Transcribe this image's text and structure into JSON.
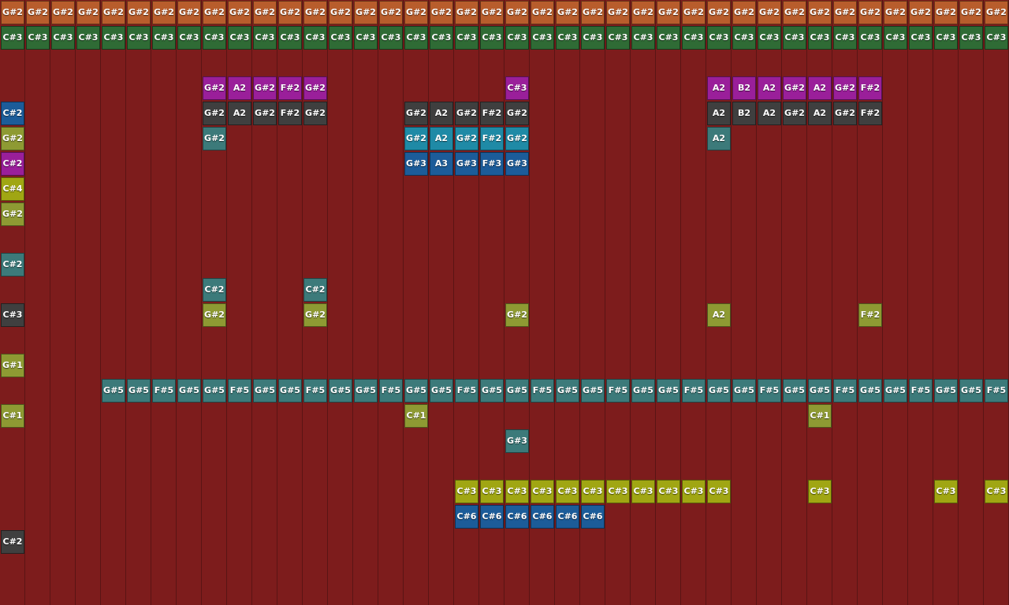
{
  "colors": {
    "background": "#7d1c1c",
    "orange": "#b85d2c",
    "green": "#2f6b35",
    "magenta": "#9a1f9a",
    "blue": "#1c5c99",
    "gray": "#3f3f3f",
    "olive": "#8e9a33",
    "cyan": "#1f8aa6",
    "teal": "#3c7a7a",
    "yellow": "#a0a613"
  },
  "tracks": [
    {
      "color": "orange",
      "notes": [
        [
          0,
          "G#2"
        ],
        [
          1,
          "G#2"
        ],
        [
          2,
          "G#2"
        ],
        [
          3,
          "G#2"
        ],
        [
          4,
          "G#2"
        ],
        [
          5,
          "G#2"
        ],
        [
          6,
          "G#2"
        ],
        [
          7,
          "G#2"
        ],
        [
          8,
          "G#2"
        ],
        [
          9,
          "G#2"
        ],
        [
          10,
          "G#2"
        ],
        [
          11,
          "G#2"
        ],
        [
          12,
          "G#2"
        ],
        [
          13,
          "G#2"
        ],
        [
          14,
          "G#2"
        ],
        [
          15,
          "G#2"
        ],
        [
          16,
          "G#2"
        ],
        [
          17,
          "G#2"
        ],
        [
          18,
          "G#2"
        ],
        [
          19,
          "G#2"
        ],
        [
          20,
          "G#2"
        ],
        [
          21,
          "G#2"
        ],
        [
          22,
          "G#2"
        ],
        [
          23,
          "G#2"
        ],
        [
          24,
          "G#2"
        ],
        [
          25,
          "G#2"
        ],
        [
          26,
          "G#2"
        ],
        [
          27,
          "G#2"
        ],
        [
          28,
          "G#2"
        ],
        [
          29,
          "G#2"
        ],
        [
          30,
          "G#2"
        ],
        [
          31,
          "G#2"
        ],
        [
          32,
          "G#2"
        ],
        [
          33,
          "G#2"
        ],
        [
          34,
          "G#2"
        ],
        [
          35,
          "G#2"
        ],
        [
          36,
          "G#2"
        ],
        [
          37,
          "G#2"
        ],
        [
          38,
          "G#2"
        ],
        [
          39,
          "G#2"
        ]
      ]
    },
    {
      "color": "green",
      "notes": [
        [
          0,
          "C#3"
        ],
        [
          1,
          "C#3"
        ],
        [
          2,
          "C#3"
        ],
        [
          3,
          "C#3"
        ],
        [
          4,
          "C#3"
        ],
        [
          5,
          "C#3"
        ],
        [
          6,
          "C#3"
        ],
        [
          7,
          "C#3"
        ],
        [
          8,
          "C#3"
        ],
        [
          9,
          "C#3"
        ],
        [
          10,
          "C#3"
        ],
        [
          11,
          "C#3"
        ],
        [
          12,
          "C#3"
        ],
        [
          13,
          "C#3"
        ],
        [
          14,
          "C#3"
        ],
        [
          15,
          "C#3"
        ],
        [
          16,
          "C#3"
        ],
        [
          17,
          "C#3"
        ],
        [
          18,
          "C#3"
        ],
        [
          19,
          "C#3"
        ],
        [
          20,
          "C#3"
        ],
        [
          21,
          "C#3"
        ],
        [
          22,
          "C#3"
        ],
        [
          23,
          "C#3"
        ],
        [
          24,
          "C#3"
        ],
        [
          25,
          "C#3"
        ],
        [
          26,
          "C#3"
        ],
        [
          27,
          "C#3"
        ],
        [
          28,
          "C#3"
        ],
        [
          29,
          "C#3"
        ],
        [
          30,
          "C#3"
        ],
        [
          31,
          "C#3"
        ],
        [
          32,
          "C#3"
        ],
        [
          33,
          "C#3"
        ],
        [
          34,
          "C#3"
        ],
        [
          35,
          "C#3"
        ],
        [
          36,
          "C#3"
        ],
        [
          37,
          "C#3"
        ],
        [
          38,
          "C#3"
        ],
        [
          39,
          "C#3"
        ]
      ]
    },
    {
      "color": "",
      "notes": []
    },
    {
      "color": "magenta",
      "notes": [
        [
          8,
          "G#2"
        ],
        [
          9,
          "A2"
        ],
        [
          10,
          "G#2"
        ],
        [
          11,
          "F#2"
        ],
        [
          12,
          "G#2"
        ],
        [
          20,
          "C#3"
        ],
        [
          28,
          "A2"
        ],
        [
          29,
          "B2"
        ],
        [
          30,
          "A2"
        ],
        [
          31,
          "G#2"
        ],
        [
          32,
          "A2"
        ],
        [
          33,
          "G#2"
        ],
        [
          34,
          "F#2"
        ]
      ]
    },
    {
      "color": "gray",
      "notes": [
        [
          8,
          "G#2"
        ],
        [
          9,
          "A2"
        ],
        [
          10,
          "G#2"
        ],
        [
          11,
          "F#2"
        ],
        [
          12,
          "G#2"
        ],
        [
          16,
          "G#2"
        ],
        [
          17,
          "A2"
        ],
        [
          18,
          "G#2"
        ],
        [
          19,
          "F#2"
        ],
        [
          20,
          "G#2"
        ],
        [
          28,
          "A2"
        ],
        [
          29,
          "B2"
        ],
        [
          30,
          "A2"
        ],
        [
          31,
          "G#2"
        ],
        [
          32,
          "A2"
        ],
        [
          33,
          "G#2"
        ],
        [
          34,
          "F#2"
        ]
      ]
    },
    {
      "color": "",
      "notes": []
    },
    {
      "color": "",
      "notes": []
    },
    {
      "color": "",
      "notes": []
    },
    {
      "color": "",
      "notes": []
    },
    {
      "color": "",
      "notes": []
    },
    {
      "color": "teal",
      "notes": [
        [
          0,
          "C#2"
        ]
      ]
    },
    {
      "color": "teal",
      "notes": [
        [
          8,
          "C#2"
        ],
        [
          12,
          "C#2"
        ]
      ]
    },
    {
      "color": "",
      "notes": []
    },
    {
      "color": "",
      "notes": []
    },
    {
      "color": "olive",
      "notes": [
        [
          0,
          "G#1"
        ]
      ]
    },
    {
      "color": "teal",
      "notes": [
        [
          4,
          "G#5"
        ],
        [
          5,
          "G#5"
        ],
        [
          6,
          "F#5"
        ],
        [
          7,
          "G#5"
        ],
        [
          8,
          "G#5"
        ],
        [
          9,
          "F#5"
        ],
        [
          10,
          "G#5"
        ],
        [
          11,
          "G#5"
        ],
        [
          12,
          "F#5"
        ],
        [
          13,
          "G#5"
        ],
        [
          14,
          "G#5"
        ],
        [
          15,
          "F#5"
        ],
        [
          16,
          "G#5"
        ],
        [
          17,
          "G#5"
        ],
        [
          18,
          "F#5"
        ],
        [
          19,
          "G#5"
        ],
        [
          20,
          "G#5"
        ],
        [
          21,
          "F#5"
        ],
        [
          22,
          "G#5"
        ],
        [
          23,
          "G#5"
        ],
        [
          24,
          "F#5"
        ],
        [
          25,
          "G#5"
        ],
        [
          26,
          "G#5"
        ],
        [
          27,
          "F#5"
        ],
        [
          28,
          "G#5"
        ],
        [
          29,
          "G#5"
        ],
        [
          30,
          "F#5"
        ],
        [
          31,
          "G#5"
        ],
        [
          32,
          "G#5"
        ],
        [
          33,
          "F#5"
        ],
        [
          34,
          "G#5"
        ],
        [
          35,
          "G#5"
        ],
        [
          36,
          "F#5"
        ],
        [
          37,
          "G#5"
        ],
        [
          38,
          "G#5"
        ],
        [
          39,
          "F#5"
        ]
      ]
    },
    {
      "color": "olive",
      "notes": [
        [
          0,
          "C#1"
        ],
        [
          16,
          "C#1"
        ],
        [
          32,
          "C#1"
        ]
      ]
    },
    {
      "color": "teal",
      "notes": [
        [
          20,
          "G#3"
        ]
      ]
    },
    {
      "color": "",
      "notes": []
    },
    {
      "color": "yellow",
      "notes": [
        [
          18,
          "C#3"
        ],
        [
          19,
          "C#3"
        ],
        [
          20,
          "C#3"
        ],
        [
          21,
          "C#3"
        ],
        [
          22,
          "C#3"
        ],
        [
          23,
          "C#3"
        ],
        [
          24,
          "C#3"
        ],
        [
          25,
          "C#3"
        ],
        [
          26,
          "C#3"
        ],
        [
          27,
          "C#3"
        ],
        [
          28,
          "C#3"
        ],
        [
          32,
          "C#3"
        ],
        [
          37,
          "C#3"
        ],
        [
          39,
          "C#3"
        ]
      ]
    },
    {
      "color": "blue",
      "notes": [
        [
          18,
          "C#6"
        ],
        [
          19,
          "C#6"
        ],
        [
          20,
          "C#6"
        ],
        [
          21,
          "C#6"
        ],
        [
          22,
          "C#6"
        ],
        [
          23,
          "C#6"
        ]
      ]
    },
    {
      "color": "gray",
      "notes": [
        [
          0,
          "C#2"
        ]
      ]
    }
  ],
  "extra_notes": [
    {
      "row": 4,
      "col": 0,
      "label": "C#2",
      "color": "blue"
    },
    {
      "row": 5,
      "col": 0,
      "label": "G#2",
      "color": "olive"
    },
    {
      "row": 5,
      "col": 8,
      "label": "G#2",
      "color": "teal"
    },
    {
      "row": 5,
      "col": 16,
      "label": "G#2",
      "color": "cyan"
    },
    {
      "row": 5,
      "col": 17,
      "label": "A2",
      "color": "cyan"
    },
    {
      "row": 5,
      "col": 18,
      "label": "G#2",
      "color": "cyan"
    },
    {
      "row": 5,
      "col": 19,
      "label": "F#2",
      "color": "cyan"
    },
    {
      "row": 5,
      "col": 20,
      "label": "G#2",
      "color": "cyan"
    },
    {
      "row": 5,
      "col": 28,
      "label": "A2",
      "color": "teal"
    },
    {
      "row": 6,
      "col": 0,
      "label": "C#2",
      "color": "magenta"
    },
    {
      "row": 6,
      "col": 16,
      "label": "G#3",
      "color": "blue"
    },
    {
      "row": 6,
      "col": 17,
      "label": "A3",
      "color": "blue"
    },
    {
      "row": 6,
      "col": 18,
      "label": "G#3",
      "color": "blue"
    },
    {
      "row": 6,
      "col": 19,
      "label": "F#3",
      "color": "blue"
    },
    {
      "row": 6,
      "col": 20,
      "label": "G#3",
      "color": "blue"
    },
    {
      "row": 7,
      "col": 0,
      "label": "C#4",
      "color": "yellow"
    },
    {
      "row": 8,
      "col": 0,
      "label": "G#2",
      "color": "olive"
    },
    {
      "row": 12,
      "col": 0,
      "label": "C#3",
      "color": "gray"
    },
    {
      "row": 12,
      "col": 8,
      "label": "G#2",
      "color": "olive"
    },
    {
      "row": 12,
      "col": 12,
      "label": "G#2",
      "color": "olive"
    },
    {
      "row": 12,
      "col": 20,
      "label": "G#2",
      "color": "olive"
    },
    {
      "row": 12,
      "col": 28,
      "label": "A2",
      "color": "olive"
    },
    {
      "row": 12,
      "col": 34,
      "label": "F#2",
      "color": "olive"
    }
  ]
}
